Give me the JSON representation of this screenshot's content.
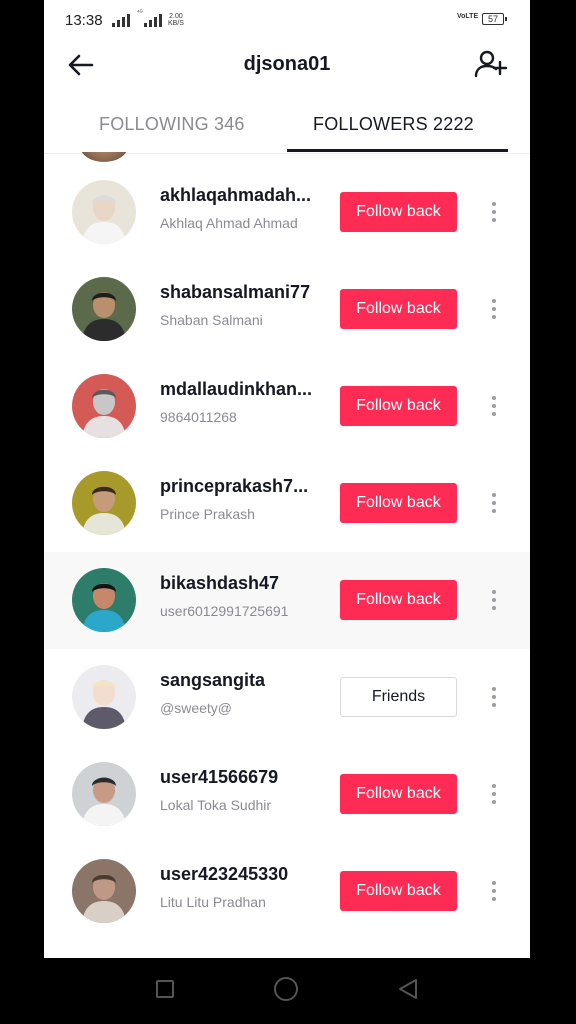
{
  "status_bar": {
    "time": "13:38",
    "net_label": "⁴ᴳ",
    "net_speed_value": "2.00",
    "net_speed_unit": "KB/S",
    "volte": "VoLTE",
    "battery": "57"
  },
  "header": {
    "title": "djsona01",
    "back_icon": "arrow-left-icon",
    "add_user_icon": "add-user-icon"
  },
  "tabs": {
    "following": "FOLLOWING 346",
    "followers": "FOLLOWERS 2222",
    "active": "followers"
  },
  "followers": [
    {
      "username": "akhlaqahmadah...",
      "subtitle": "Akhlaq Ahmad Ahmad",
      "button": "Follow back",
      "button_type": "follow"
    },
    {
      "username": "shabansalmani77",
      "subtitle": "Shaban Salmani",
      "button": "Follow back",
      "button_type": "follow"
    },
    {
      "username": "mdallaudinkhan...",
      "subtitle": "9864011268",
      "button": "Follow back",
      "button_type": "follow"
    },
    {
      "username": "princeprakash7...",
      "subtitle": "Prince Prakash",
      "button": "Follow back",
      "button_type": "follow"
    },
    {
      "username": "bikashdash47",
      "subtitle": "user6012991725691",
      "button": "Follow back",
      "button_type": "follow"
    },
    {
      "username": "sangsangita",
      "subtitle": "@sweety@",
      "button": "Friends",
      "button_type": "friends"
    },
    {
      "username": "user41566679",
      "subtitle": "Lokal Toka Sudhir",
      "button": "Follow back",
      "button_type": "follow"
    },
    {
      "username": "user423245330",
      "subtitle": "Litu Litu Pradhan",
      "button": "Follow back",
      "button_type": "follow"
    }
  ],
  "colors": {
    "accent": "#fe2c55",
    "text_primary": "#161823",
    "text_secondary": "#8a8b91"
  },
  "system_nav": {
    "recents_icon": "square-icon",
    "home_icon": "circle-icon",
    "back_icon": "triangle-back-icon"
  }
}
